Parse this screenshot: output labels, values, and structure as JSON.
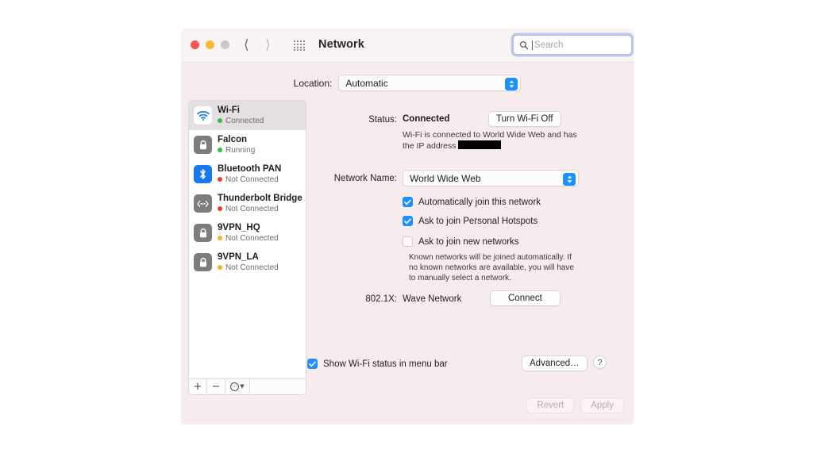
{
  "window": {
    "title": "Network",
    "traffic_lights": [
      "close",
      "minimize",
      "zoom"
    ],
    "nav_back_icon": "chevron-left-icon",
    "nav_forward_icon": "chevron-right-icon",
    "grid_icon": "grid-apps-icon",
    "search": {
      "placeholder": "Search",
      "value": "",
      "icon": "magnifier-icon"
    }
  },
  "location": {
    "label": "Location:",
    "value": "Automatic"
  },
  "sidebar": {
    "services": [
      {
        "name": "Wi-Fi",
        "status": "Connected",
        "dot": "green",
        "icon": "wifi-icon",
        "selected": true
      },
      {
        "name": "Falcon",
        "status": "Running",
        "dot": "green",
        "icon": "lock-icon",
        "selected": false
      },
      {
        "name": "Bluetooth PAN",
        "status": "Not Connected",
        "dot": "red",
        "icon": "bluetooth-icon",
        "selected": false
      },
      {
        "name": "Thunderbolt Bridge",
        "status": "Not Connected",
        "dot": "red",
        "icon": "thunderbolt-icon",
        "selected": false
      },
      {
        "name": "9VPN_HQ",
        "status": "Not Connected",
        "dot": "yellow",
        "icon": "lock-icon",
        "selected": false
      },
      {
        "name": "9VPN_LA",
        "status": "Not Connected",
        "dot": "yellow",
        "icon": "lock-icon",
        "selected": false
      }
    ],
    "footer": {
      "add_label": "+",
      "remove_label": "−",
      "options_icon": "gear-icon",
      "options_chevron": "⌄"
    }
  },
  "detail": {
    "status_label": "Status:",
    "status_value": "Connected",
    "turn_off_button": "Turn Wi-Fi Off",
    "status_desc_before": "Wi-Fi is connected to World Wide Web and has the IP address",
    "status_desc_redacted": true,
    "network_name_label": "Network Name:",
    "network_name_value": "World Wide Web",
    "checkboxes": [
      {
        "label": "Automatically join this network",
        "checked": true
      },
      {
        "label": "Ask to join Personal Hotspots",
        "checked": true
      },
      {
        "label": "Ask to join new networks",
        "checked": false
      }
    ],
    "known_networks_note": "Known networks will be joined automatically. If no known networks are available, you will have to manually select a network.",
    "dot1x_label": "802.1X:",
    "dot1x_value": "Wave Network",
    "connect_button": "Connect",
    "menubar_checkbox": {
      "label": "Show Wi-Fi status in menu bar",
      "checked": true
    },
    "advanced_button": "Advanced…",
    "help_button": "?"
  },
  "footer": {
    "revert_button": "Revert",
    "apply_button": "Apply"
  },
  "colors": {
    "accent_blue": "#1e8fff",
    "window_body": "#f7eced",
    "titlebar": "#faf3f4",
    "status_green": "#2fc04a",
    "status_red": "#ef3b2d",
    "status_yellow": "#f4b51f"
  }
}
